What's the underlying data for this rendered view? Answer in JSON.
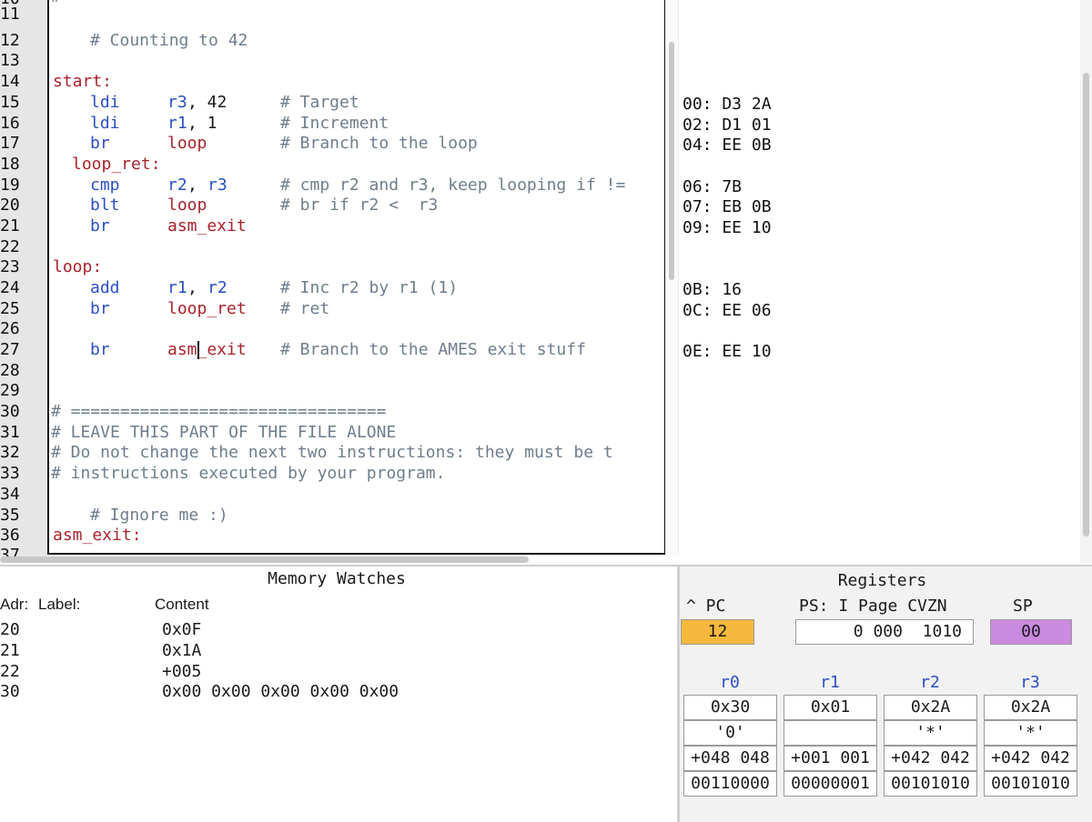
{
  "editor": {
    "line_numbers": [
      "11",
      "12",
      "13",
      "14",
      "15",
      "16",
      "17",
      "18",
      "19",
      "20",
      "21",
      "22",
      "23",
      "24",
      "25",
      "26",
      "27",
      "28",
      "29",
      "30",
      "31",
      "32",
      "33",
      "34",
      "35",
      "36"
    ],
    "top_partial_text": "# ========================================================",
    "lines": {
      "l12": "# Counting to 42",
      "l14": "start:",
      "l15_op": "ldi",
      "l15_args_a": "r3",
      "l15_args_b": ", 42",
      "l15_comment": "# Target",
      "l16_op": "ldi",
      "l16_args_a": "r1",
      "l16_args_b": ", 1",
      "l16_comment": "# Increment",
      "l17_op": "br",
      "l17_args": "loop",
      "l17_comment": "# Branch to the loop",
      "l18": "loop_ret:",
      "l19_op": "cmp",
      "l19_args_a": "r2",
      "l19_args_b": ", ",
      "l19_args_c": "r3",
      "l19_comment": "# cmp r2 and r3, keep looping if !=",
      "l20_op": "blt",
      "l20_args": "loop",
      "l20_comment": "# br if r2 <  r3",
      "l21_op": "br",
      "l21_args": "asm_exit",
      "l23": "loop:",
      "l24_op": "add",
      "l24_args_a": "r1",
      "l24_args_b": ", ",
      "l24_args_c": "r2",
      "l24_comment": "# Inc r2 by r1 (1)",
      "l25_op": "br",
      "l25_args": "loop_ret",
      "l25_comment": "# ret",
      "l27_op": "br",
      "l27_args": "asm_exit",
      "l27_comment": "# Branch to the AMES exit stuff",
      "l30": "# ================================",
      "l31": "# LEAVE THIS PART OF THE FILE ALONE",
      "l32": "# Do not change the next two instructions: they must be t",
      "l33": "# instructions executed by your program.",
      "l35": "# Ignore me :)",
      "l36": "asm_exit:"
    }
  },
  "hex": {
    "l15": "00: D3 2A",
    "l16": "02: D1 01",
    "l17": "04: EE 0B",
    "l19": "06: 7B",
    "l20": "07: EB 0B",
    "l21": "09: EE 10",
    "l24": "0B: 16",
    "l25": "0C: EE 06",
    "l27": "0E: EE 10"
  },
  "memory_watches": {
    "title": "Memory Watches",
    "col_adr": "Adr:",
    "col_label": "Label:",
    "col_content": "Content",
    "rows": [
      {
        "adr": "20",
        "content": "0x0F"
      },
      {
        "adr": "21",
        "content": "0x1A"
      },
      {
        "adr": "22",
        "content": "+005"
      },
      {
        "adr": "30",
        "content": "0x00 0x00 0x00 0x00 0x00"
      }
    ]
  },
  "registers": {
    "title": "Registers",
    "pc_label": "^ PC",
    "ps_label": "PS: I Page CVZN",
    "sp_label": "SP",
    "pc_value": "12",
    "ps_value": "0 000  1010",
    "sp_value": "00",
    "pc_color": "#f5b83d",
    "sp_color": "#c98ae0",
    "regs": [
      {
        "name": "r0",
        "hex": "0x30",
        "char": "'0'",
        "dec": "+048 048",
        "bin": "00110000"
      },
      {
        "name": "r1",
        "hex": "0x01",
        "char": "",
        "dec": "+001 001",
        "bin": "00000001"
      },
      {
        "name": "r2",
        "hex": "0x2A",
        "char": "'*'",
        "dec": "+042 042",
        "bin": "00101010"
      },
      {
        "name": "r3",
        "hex": "0x2A",
        "char": "'*'",
        "dec": "+042 042",
        "bin": "00101010"
      }
    ]
  }
}
